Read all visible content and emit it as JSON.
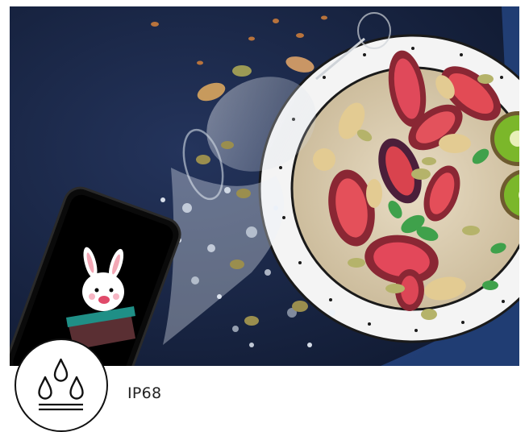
{
  "feature": {
    "label": "IP68",
    "icon": "water-drops-icon"
  },
  "photo": {
    "subject": "phone-splash-food-bowl-image",
    "mascot": "bunny-hat-icon"
  },
  "colors": {
    "background": "#ffffff",
    "table": "#19284a",
    "text": "#222222",
    "icon_stroke": "#111111"
  }
}
